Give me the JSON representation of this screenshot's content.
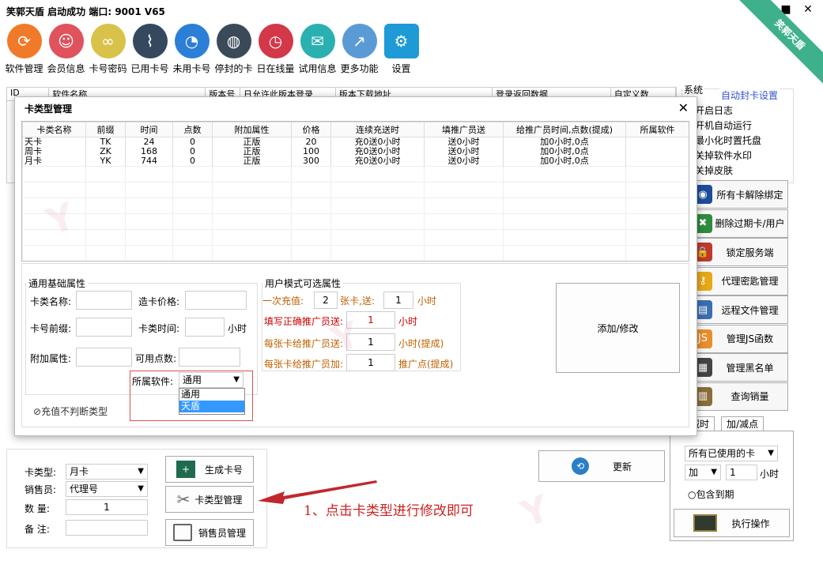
{
  "window": {
    "title": "笑郭天盾  启动成功   端口: 9001  V65",
    "ribbon_text": "笑郭天盾",
    "minimize": "▬",
    "maximize": "■",
    "close": "✕"
  },
  "toolbar": [
    {
      "label": "软件管理",
      "icon": "refresh-icon",
      "color": "#f07a2a"
    },
    {
      "label": "会员信息",
      "icon": "members-icon",
      "color": "#e0525c"
    },
    {
      "label": "卡号密码",
      "icon": "link-icon",
      "color": "#d9c24a"
    },
    {
      "label": "已用卡号",
      "icon": "paperclip-icon",
      "color": "#34495e"
    },
    {
      "label": "未用卡号",
      "icon": "pie-icon",
      "color": "#2b7fd6"
    },
    {
      "label": "停封的卡",
      "icon": "globe-icon",
      "color": "#3a4a58"
    },
    {
      "label": "日在线量",
      "icon": "clock-icon",
      "color": "#d23848"
    },
    {
      "label": "试用信息",
      "icon": "megaphone-icon",
      "color": "#2ab0b0"
    },
    {
      "label": "更多功能",
      "icon": "chart-icon",
      "color": "#5b9bd5"
    },
    {
      "label": "设置",
      "icon": "gear-icon",
      "color": "#1e9ad6"
    }
  ],
  "bg_table": {
    "headers": [
      "ID",
      "软件名称",
      "版本号",
      "日允许此版本登录",
      "版本下载地址",
      "登录返回数据",
      "自定义数"
    ]
  },
  "system_panel": {
    "title": "系统",
    "link": "自动封卡设置",
    "items": [
      "开启日志",
      "开机自动运行",
      "最小化时置托盘",
      "关掉软件水印",
      "关掉皮肤"
    ]
  },
  "right_buttons": [
    {
      "label": "所有卡解除绑定",
      "icon": "unbind-icon",
      "color": "#1c4d9c"
    },
    {
      "label": "删除过期卡/用户",
      "icon": "delete-icon",
      "color": "#2e8b3e"
    },
    {
      "label": "锁定服务端",
      "icon": "lock-icon",
      "color": "#c0392b"
    },
    {
      "label": "代理密匙管理",
      "icon": "key-icon",
      "color": "#e6a817"
    },
    {
      "label": "远程文件管理",
      "icon": "file-icon",
      "color": "#3a6fb0"
    },
    {
      "label": "管理JS函数",
      "icon": "js-icon",
      "color": "#e88f2c"
    },
    {
      "label": "管理黑名单",
      "icon": "blacklist-icon",
      "color": "#444444"
    },
    {
      "label": "查询销量",
      "icon": "sales-icon",
      "color": "#8a6d3b"
    }
  ],
  "dialog": {
    "title": "卡类型管理",
    "close": "✕",
    "columns": [
      "卡类名称",
      "前缀",
      "时间",
      "点数",
      "附加属性",
      "价格",
      "连续充送时",
      "填推广员送",
      "给推广员时间,点数(提成)",
      "所属软件"
    ],
    "rows": [
      [
        "天卡",
        "TK",
        "24",
        "0",
        "正版",
        "20",
        "充0送0小时",
        "送0小时",
        "加0小时,0点",
        ""
      ],
      [
        "周卡",
        "ZK",
        "168",
        "0",
        "正版",
        "100",
        "充0送0小时",
        "送0小时",
        "加0小时,0点",
        ""
      ],
      [
        "月卡",
        "YK",
        "744",
        "0",
        "正版",
        "300",
        "充0送0小时",
        "送0小时",
        "加0小时,0点",
        ""
      ]
    ],
    "basic": {
      "legend": "通用基础属性",
      "name_label": "卡类名称:",
      "price_label": "造卡价格:",
      "prefix_label": "卡号前缀:",
      "time_label": "卡类时间:",
      "hour_unit": "小时",
      "attr_label": "附加属性:",
      "points_label": "可用点数:",
      "software_label": "所属软件:",
      "software_value": "通用",
      "software_options": [
        "通用",
        "天盾"
      ],
      "check_label": "充值不判断类型"
    },
    "user_mode": {
      "legend": "用户模式可选属性",
      "recharge_label": "一次充值:",
      "recharge_value": "2",
      "recharge_mid": "张卡,送:",
      "recharge_gift": "1",
      "recharge_unit": "小时",
      "promoter_label": "填写正确推广员送:",
      "promoter_value": "1",
      "promoter_unit": "小时",
      "per_card_label": "每张卡给推广员送:",
      "per_card_value": "1",
      "per_card_unit": "小时(提成)",
      "per_card_add_label": "每张卡给推广员加:",
      "per_card_add_value": "1",
      "per_card_add_unit": "推广点(提成)"
    },
    "add_button": "添加/修改"
  },
  "bottom": {
    "card_type_label": "卡类型:",
    "card_type_value": "月卡",
    "seller_label": "销售员:",
    "seller_value": "代理号",
    "qty_label": "数  量:",
    "qty_value": "1",
    "note_label": "备  注:",
    "gen_button": "生成卡号",
    "type_mgr_button": "卡类型管理",
    "seller_mgr_button": "销售员管理",
    "refresh_button": "更新"
  },
  "bottom_right": {
    "tab1": "减时",
    "tab2": "加/减点",
    "scope_value": "所有已使用的卡",
    "op_value": "加",
    "amount_value": "1",
    "unit": "小时",
    "expired_label": "包含到期",
    "exec_button": "执行操作"
  },
  "annotation": "1、点击卡类型进行修改即可",
  "colors": {
    "highlight": "#3399ff",
    "red_box": "#d9534f",
    "arrow": "#c0282d"
  }
}
